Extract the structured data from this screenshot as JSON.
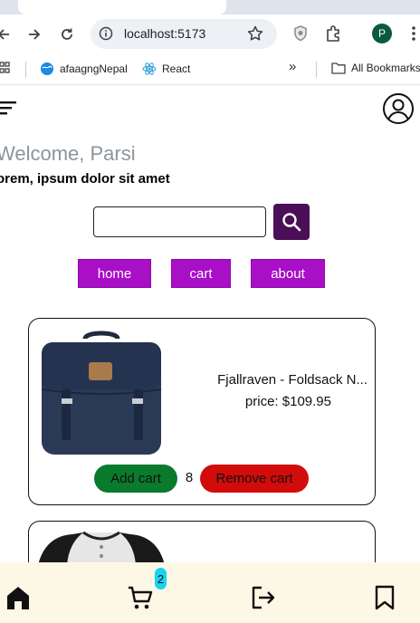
{
  "browser": {
    "url": "localhost:5173",
    "profile_initial": "P",
    "bookmarks": [
      {
        "label": "afaagngNepal",
        "icon": "globe-icon"
      },
      {
        "label": "React",
        "icon": "react-icon"
      }
    ],
    "all_bookmarks_label": "All Bookmarks",
    "overflow_label": "»"
  },
  "app": {
    "welcome": "Welcome, Parsi",
    "subtitle": "orem, ipsum dolor sit amet",
    "search": {
      "value": "",
      "placeholder": ""
    },
    "nav": [
      {
        "label": "home"
      },
      {
        "label": "cart"
      },
      {
        "label": "about"
      }
    ],
    "products": [
      {
        "title": "Fjallraven - Foldsack N...",
        "price": "price: $109.95",
        "add_label": "Add cart",
        "quantity": "8",
        "remove_label": "Remove cart",
        "image": "backpack"
      },
      {
        "image": "raglan-shirt"
      }
    ],
    "bottom_nav": {
      "cart_badge": "2",
      "icons": [
        "home-icon",
        "cart-icon",
        "logout-icon",
        "bookmark-icon"
      ]
    },
    "colors": {
      "nav_pill": "#a80fc7",
      "search_button": "#4b0f58",
      "add_button": "#0a7a2c",
      "remove_button": "#d20b0b",
      "bottom_nav_bg": "#fdf8e5",
      "badge": "#18d4ee"
    }
  }
}
